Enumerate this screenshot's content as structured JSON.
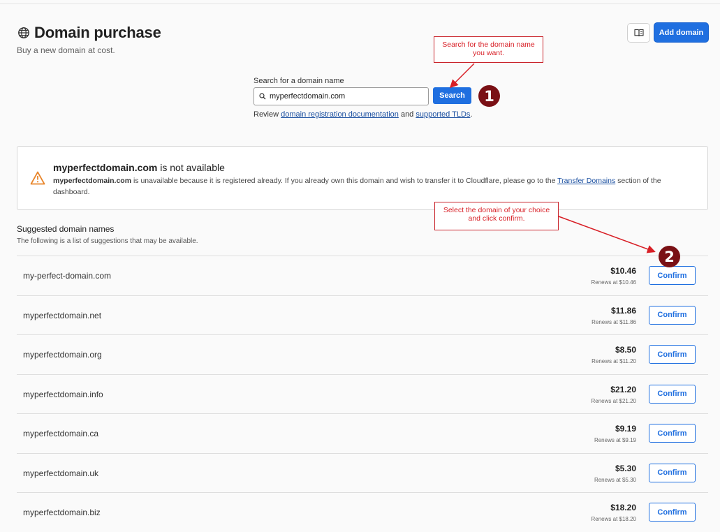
{
  "header": {
    "title": "Domain purchase",
    "subtitle": "Buy a new domain at cost.",
    "add_domain_label": "Add domain"
  },
  "search": {
    "label": "Search for a domain name",
    "value": "myperfectdomain.com",
    "button_label": "Search",
    "review_prefix": "Review ",
    "review_link1": "domain registration documentation",
    "review_and": " and ",
    "review_link2": "supported TLDs",
    "review_suffix": "."
  },
  "annotations": {
    "callout1": "Search for the domain name you want.",
    "callout2": "Select the domain of your choice and click confirm.",
    "badge1": "1",
    "badge2": "2",
    "color": "#d81f26"
  },
  "alert": {
    "domain": "myperfectdomain.com",
    "title_suffix": " is not available",
    "body_domain": "myperfectdomain.com",
    "body_text": " is unavailable because it is registered already. If you already own this domain and wish to transfer it to Cloudflare, please go to the ",
    "body_link": "Transfer Domains",
    "body_end": " section of the dashboard.",
    "icon": "warning-icon",
    "icon_color": "#e8852a"
  },
  "suggestions": {
    "title": "Suggested domain names",
    "subtitle": "The following is a list of suggestions that may be available.",
    "confirm_label": "Confirm",
    "items": [
      {
        "name": "my-perfect-domain.com",
        "price": "$10.46",
        "renews": "Renews at $10.46"
      },
      {
        "name": "myperfectdomain.net",
        "price": "$11.86",
        "renews": "Renews at $11.86"
      },
      {
        "name": "myperfectdomain.org",
        "price": "$8.50",
        "renews": "Renews at $11.20"
      },
      {
        "name": "myperfectdomain.info",
        "price": "$21.20",
        "renews": "Renews at $21.20"
      },
      {
        "name": "myperfectdomain.ca",
        "price": "$9.19",
        "renews": "Renews at $9.19"
      },
      {
        "name": "myperfectdomain.uk",
        "price": "$5.30",
        "renews": "Renews at $5.30"
      },
      {
        "name": "myperfectdomain.biz",
        "price": "$18.20",
        "renews": "Renews at $18.20"
      }
    ]
  },
  "colors": {
    "primary": "#1f6fe0",
    "badge": "#7a1015"
  }
}
